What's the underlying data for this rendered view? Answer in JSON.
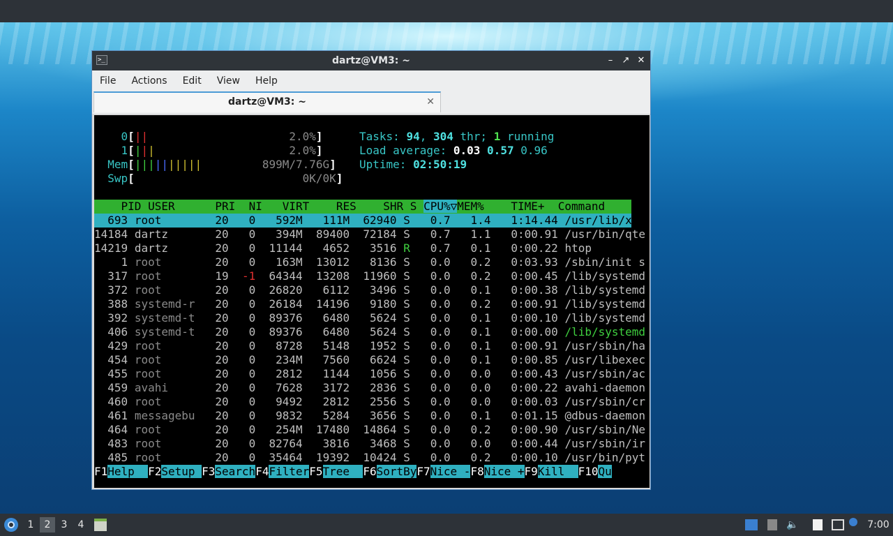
{
  "window": {
    "title": "dartz@VM3: ~",
    "tab_title": "dartz@VM3: ~",
    "menu": [
      "File",
      "Actions",
      "Edit",
      "View",
      "Help"
    ]
  },
  "htop": {
    "cpu0": {
      "label": "0",
      "value": "2.0%"
    },
    "cpu1": {
      "label": "1",
      "value": "2.0%"
    },
    "mem": {
      "label": "Mem",
      "value": "899M/7.76G"
    },
    "swp": {
      "label": "Swp",
      "value": "0K/0K"
    },
    "tasks": {
      "label": "Tasks:",
      "count": "94",
      "thr": "304",
      "thr_label": "thr;",
      "running": "1",
      "running_label": "running"
    },
    "load": {
      "label": "Load average:",
      "l1": "0.03",
      "l5": "0.57",
      "l15": "0.96"
    },
    "uptime": {
      "label": "Uptime:",
      "value": "02:50:19"
    },
    "columns": [
      "PID",
      "USER",
      "PRI",
      "NI",
      "VIRT",
      "RES",
      "SHR",
      "S",
      "CPU%▽",
      "MEM%",
      "TIME+",
      "Command"
    ],
    "processes": [
      [
        "693",
        "root",
        "20",
        "0",
        "592M",
        "111M",
        "62940",
        "S",
        "0.7",
        "1.4",
        "1:14.44",
        "/usr/lib/xor"
      ],
      [
        "14184",
        "dartz",
        "20",
        "0",
        "394M",
        "89400",
        "72184",
        "S",
        "0.7",
        "1.1",
        "0:00.91",
        "/usr/bin/qte"
      ],
      [
        "14219",
        "dartz",
        "20",
        "0",
        "11144",
        "4652",
        "3516",
        "R",
        "0.7",
        "0.1",
        "0:00.22",
        "htop"
      ],
      [
        "1",
        "root",
        "20",
        "0",
        "163M",
        "13012",
        "8136",
        "S",
        "0.0",
        "0.2",
        "0:03.93",
        "/sbin/init s"
      ],
      [
        "317",
        "root",
        "19",
        "-1",
        "64344",
        "13208",
        "11960",
        "S",
        "0.0",
        "0.2",
        "0:00.45",
        "/lib/systemd"
      ],
      [
        "372",
        "root",
        "20",
        "0",
        "26820",
        "6112",
        "3496",
        "S",
        "0.0",
        "0.1",
        "0:00.38",
        "/lib/systemd"
      ],
      [
        "388",
        "systemd-r",
        "20",
        "0",
        "26184",
        "14196",
        "9180",
        "S",
        "0.0",
        "0.2",
        "0:00.91",
        "/lib/systemd"
      ],
      [
        "392",
        "systemd-t",
        "20",
        "0",
        "89376",
        "6480",
        "5624",
        "S",
        "0.0",
        "0.1",
        "0:00.10",
        "/lib/systemd"
      ],
      [
        "406",
        "systemd-t",
        "20",
        "0",
        "89376",
        "6480",
        "5624",
        "S",
        "0.0",
        "0.1",
        "0:00.00",
        "/lib/systemd"
      ],
      [
        "429",
        "root",
        "20",
        "0",
        "8728",
        "5148",
        "1952",
        "S",
        "0.0",
        "0.1",
        "0:00.91",
        "/usr/sbin/ha"
      ],
      [
        "454",
        "root",
        "20",
        "0",
        "234M",
        "7560",
        "6624",
        "S",
        "0.0",
        "0.1",
        "0:00.85",
        "/usr/libexec"
      ],
      [
        "455",
        "root",
        "20",
        "0",
        "2812",
        "1144",
        "1056",
        "S",
        "0.0",
        "0.0",
        "0:00.43",
        "/usr/sbin/ac"
      ],
      [
        "459",
        "avahi",
        "20",
        "0",
        "7628",
        "3172",
        "2836",
        "S",
        "0.0",
        "0.0",
        "0:00.22",
        "avahi-daemon"
      ],
      [
        "460",
        "root",
        "20",
        "0",
        "9492",
        "2812",
        "2556",
        "S",
        "0.0",
        "0.0",
        "0:00.03",
        "/usr/sbin/cr"
      ],
      [
        "461",
        "messagebu",
        "20",
        "0",
        "9832",
        "5284",
        "3656",
        "S",
        "0.0",
        "0.1",
        "0:01.15",
        "@dbus-daemon"
      ],
      [
        "464",
        "root",
        "20",
        "0",
        "254M",
        "17480",
        "14864",
        "S",
        "0.0",
        "0.2",
        "0:00.90",
        "/usr/sbin/Ne"
      ],
      [
        "483",
        "root",
        "20",
        "0",
        "82764",
        "3816",
        "3468",
        "S",
        "0.0",
        "0.0",
        "0:00.44",
        "/usr/sbin/ir"
      ],
      [
        "485",
        "root",
        "20",
        "0",
        "35464",
        "19392",
        "10424",
        "S",
        "0.0",
        "0.2",
        "0:00.10",
        "/usr/bin/pyt"
      ]
    ],
    "fkeys": [
      {
        "key": "F1",
        "label": "Help  "
      },
      {
        "key": "F2",
        "label": "Setup "
      },
      {
        "key": "F3",
        "label": "Search"
      },
      {
        "key": "F4",
        "label": "Filter"
      },
      {
        "key": "F5",
        "label": "Tree  "
      },
      {
        "key": "F6",
        "label": "SortBy"
      },
      {
        "key": "F7",
        "label": "Nice -"
      },
      {
        "key": "F8",
        "label": "Nice +"
      },
      {
        "key": "F9",
        "label": "Kill  "
      },
      {
        "key": "F10",
        "label": "Qu"
      }
    ]
  },
  "taskbar": {
    "desktops": [
      "1",
      "2",
      "3",
      "4"
    ],
    "active_desktop": "2",
    "clock": "7:00"
  }
}
